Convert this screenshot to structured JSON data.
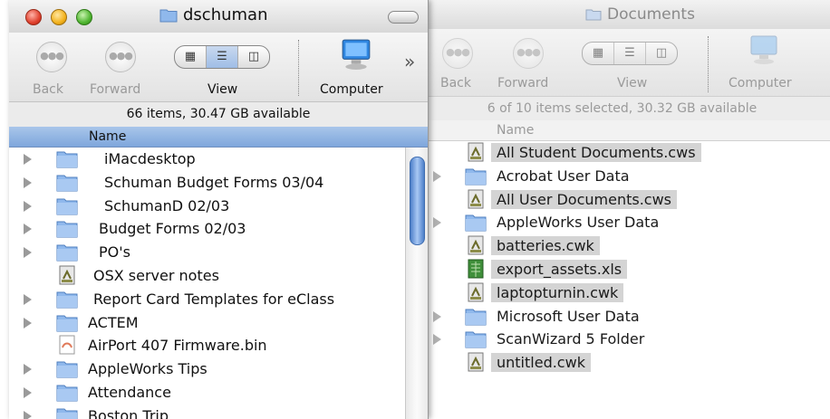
{
  "front_window": {
    "title": "dschuman",
    "toolbar": {
      "back_label": "Back",
      "forward_label": "Forward",
      "view_label": "View",
      "computer_label": "Computer",
      "overflow": "»"
    },
    "status": "66 items, 30.47 GB available",
    "column_header": "Name",
    "items": [
      {
        "label": "iMacdesktop",
        "kind": "folder",
        "expandable": true
      },
      {
        "label": "Schuman Budget Forms 03/04",
        "kind": "folder",
        "expandable": true
      },
      {
        "label": "SchumanD 02/03",
        "kind": "folder",
        "expandable": true
      },
      {
        "label": "Budget Forms 02/03",
        "kind": "folder",
        "expandable": true
      },
      {
        "label": "PO's",
        "kind": "folder",
        "expandable": true
      },
      {
        "label": "OSX server notes",
        "kind": "document",
        "expandable": false
      },
      {
        "label": "Report Card Templates for eClass",
        "kind": "folder",
        "expandable": true
      },
      {
        "label": "ACTEM",
        "kind": "folder",
        "expandable": true
      },
      {
        "label": "AirPort 407 Firmware.bin",
        "kind": "binary",
        "expandable": false
      },
      {
        "label": "AppleWorks Tips",
        "kind": "folder",
        "expandable": true
      },
      {
        "label": "Attendance",
        "kind": "folder",
        "expandable": true
      },
      {
        "label": "Boston Trip",
        "kind": "folder",
        "expandable": true
      }
    ]
  },
  "back_window": {
    "title": "Documents",
    "toolbar": {
      "back_label": "Back",
      "forward_label": "Forward",
      "view_label": "View",
      "computer_label": "Computer"
    },
    "status": "6 of 10 items selected, 30.32 GB available",
    "column_header": "Name",
    "items": [
      {
        "label": "All Student Documents.cws",
        "kind": "document",
        "selected": true,
        "expandable": false
      },
      {
        "label": "Acrobat User Data",
        "kind": "folder",
        "selected": false,
        "expandable": true
      },
      {
        "label": "All User Documents.cws",
        "kind": "document",
        "selected": true,
        "expandable": false
      },
      {
        "label": "AppleWorks User Data",
        "kind": "folder",
        "selected": false,
        "expandable": true
      },
      {
        "label": "batteries.cwk",
        "kind": "document",
        "selected": true,
        "expandable": false
      },
      {
        "label": "export_assets.xls",
        "kind": "spreadsheet",
        "selected": true,
        "expandable": false
      },
      {
        "label": "laptopturnin.cwk",
        "kind": "document",
        "selected": true,
        "expandable": false
      },
      {
        "label": "Microsoft User Data",
        "kind": "folder",
        "selected": false,
        "expandable": true
      },
      {
        "label": "ScanWizard 5 Folder",
        "kind": "folder",
        "selected": false,
        "expandable": true
      },
      {
        "label": "untitled.cwk",
        "kind": "document",
        "selected": true,
        "expandable": false
      }
    ]
  },
  "colors": {
    "selection_inactive": "#d4d4d4",
    "header_active": "#9fbde6",
    "folder_blue": "#8fb8ec"
  },
  "icons": {
    "folder": "folder-icon",
    "document": "appleworks-document-icon",
    "spreadsheet": "excel-spreadsheet-icon",
    "binary": "firmware-binary-icon",
    "computer": "computer-icon"
  }
}
